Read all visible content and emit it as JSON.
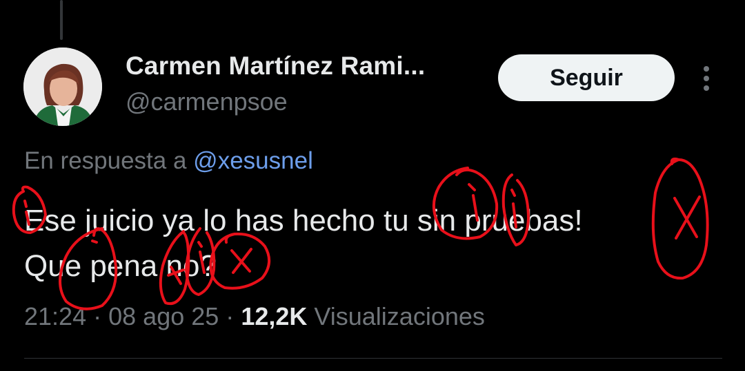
{
  "tweet": {
    "author_name": "Carmen Martínez Rami...",
    "author_handle": "@carmenpsoe",
    "follow_label": "Seguir",
    "reply_prefix": "En respuesta a",
    "reply_to": "@xesusnel",
    "text_line1": "Ese juicio ya lo has hecho tu sin pruebas!",
    "text_line2": "Que pena no?",
    "time": "21:24",
    "separator": "·",
    "date": "08 ago 25",
    "views_count": "12,2K",
    "views_label": "Visualizaciones"
  },
  "icons": {
    "more": "more-vertical-icon",
    "avatar": "profile-photo"
  },
  "colors": {
    "background": "#000000",
    "text_primary": "#e7e9ea",
    "text_secondary": "#71767b",
    "mention": "#6d9eeb",
    "follow_bg": "#eff3f4",
    "annotation_red": "#e8101a"
  }
}
